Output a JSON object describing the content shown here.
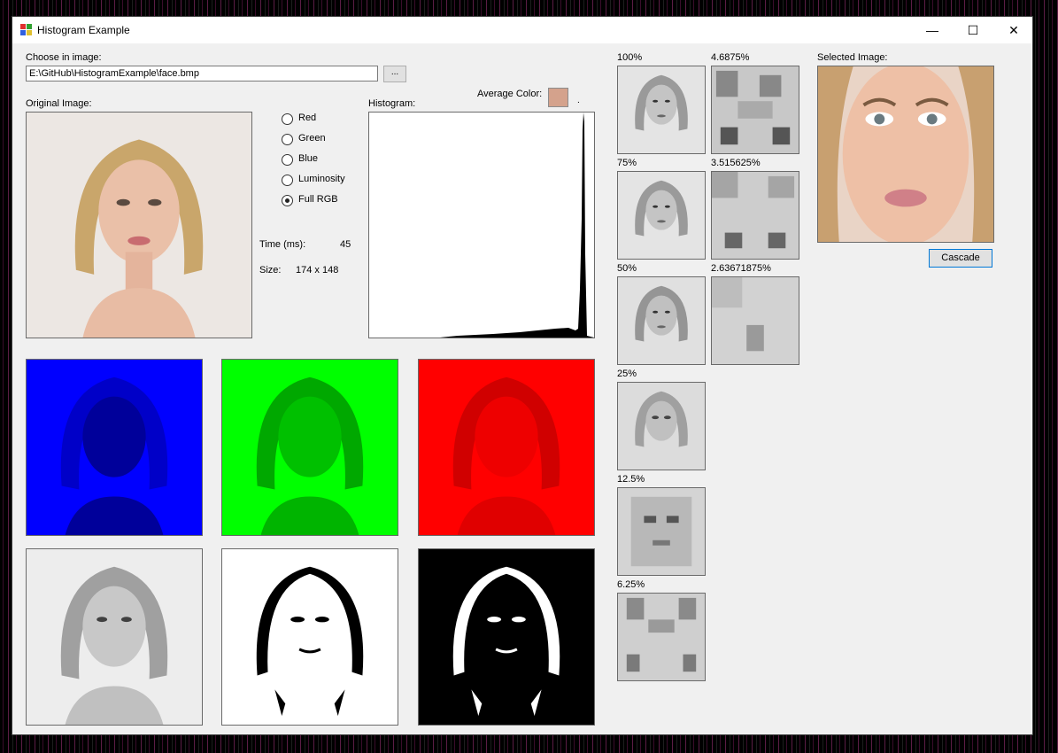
{
  "window": {
    "title": "Histogram Example"
  },
  "controls": {
    "minimize": "—",
    "maximize": "☐",
    "close": "✕"
  },
  "file": {
    "label": "Choose in image:",
    "path": "E:\\GitHub\\HistogramExample\\face.bmp",
    "browse_label": "..."
  },
  "original_label": "Original Image:",
  "histogram_label": "Histogram:",
  "average_color": {
    "label": "Average Color:",
    "value": "#d4a28c",
    "dot": "."
  },
  "channels": [
    {
      "label": "Red",
      "selected": false
    },
    {
      "label": "Green",
      "selected": false
    },
    {
      "label": "Blue",
      "selected": false
    },
    {
      "label": "Luminosity",
      "selected": false
    },
    {
      "label": "Full RGB",
      "selected": true
    }
  ],
  "stats": {
    "time_label": "Time (ms):",
    "time_value": "45",
    "size_label": "Size:",
    "size_value": "174 x 148"
  },
  "scales_left": [
    "100%",
    "75%",
    "50%",
    "25%",
    "12.5%",
    "6.25%"
  ],
  "scales_right": [
    "4.6875%",
    "3.515625%",
    "2.63671875%"
  ],
  "selected_label": "Selected Image:",
  "cascade_label": "Cascade",
  "channel_images": [
    "blue-channel",
    "green-channel",
    "red-channel",
    "grayscale",
    "threshold",
    "inverted-threshold"
  ]
}
